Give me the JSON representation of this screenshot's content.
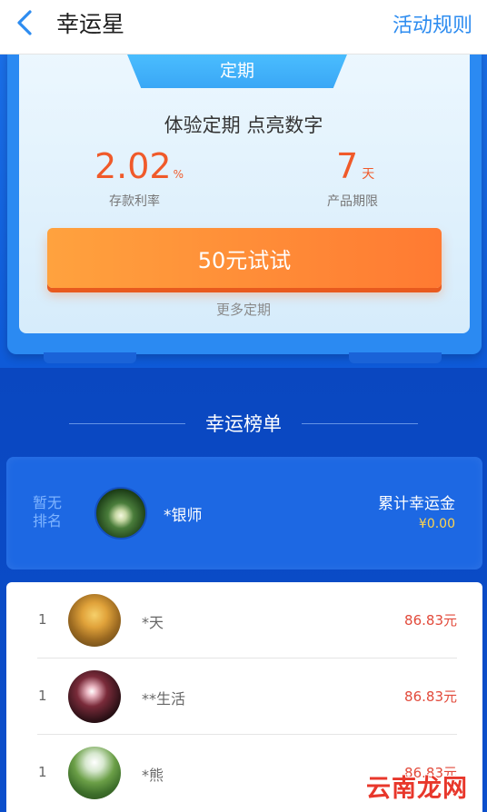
{
  "header": {
    "title": "幸运星",
    "rules_label": "活动规则"
  },
  "product": {
    "tab_label": "定期",
    "tagline": "体验定期 点亮数字",
    "rate_value": "2.02",
    "rate_unit": "%",
    "rate_label": "存款利率",
    "term_value": "7",
    "term_unit": "天",
    "term_label": "产品期限",
    "try_button": "50元试试",
    "more_link": "更多定期"
  },
  "ranking": {
    "title": "幸运榜单",
    "me": {
      "rank_text": "暂无排名",
      "name": "*银师",
      "total_label": "累计幸运金",
      "total_value": "¥0.00"
    },
    "items": [
      {
        "rank": "1",
        "name": "*天",
        "amount": "86.83元"
      },
      {
        "rank": "1",
        "name": "**生活",
        "amount": "86.83元"
      },
      {
        "rank": "1",
        "name": "*熊",
        "amount": "86.83元"
      }
    ]
  },
  "watermark": "云南龙网"
}
